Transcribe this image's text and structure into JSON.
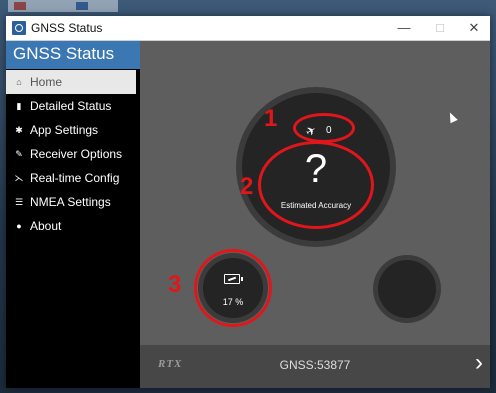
{
  "window": {
    "title": "GNSS Status",
    "controls": {
      "minimize": "—",
      "maximize": "□",
      "close": "✕"
    }
  },
  "sidebar": {
    "title": "GNSS Status",
    "items": [
      {
        "label": "Home",
        "icon": "home-icon",
        "glyph": "⌂",
        "active": true
      },
      {
        "label": "Detailed Status",
        "icon": "bar-chart-icon",
        "glyph": "▮",
        "active": false
      },
      {
        "label": "App Settings",
        "icon": "gear-icon",
        "glyph": "✱",
        "active": false
      },
      {
        "label": "Receiver Options",
        "icon": "wrench-icon",
        "glyph": "✎",
        "active": false
      },
      {
        "label": "Real-time Config",
        "icon": "satellite-dish-icon",
        "glyph": "⋋",
        "active": false
      },
      {
        "label": "NMEA Settings",
        "icon": "sliders-icon",
        "glyph": "☰",
        "active": false
      },
      {
        "label": "About",
        "icon": "info-icon",
        "glyph": "●",
        "active": false
      }
    ]
  },
  "main": {
    "satellite_count": "0",
    "accuracy_value": "?",
    "accuracy_label": "Estimated Accuracy",
    "battery_percent": "17 %",
    "annotations": [
      "1",
      "2",
      "3"
    ]
  },
  "footer": {
    "logo": "RTX",
    "gnss_label": "GNSS:53877",
    "next_glyph": "›"
  },
  "colors": {
    "accent": "#3a77b3",
    "annotation": "#e0161b",
    "sidebar_bg": "#000000",
    "main_bg": "#5e5e5e"
  }
}
